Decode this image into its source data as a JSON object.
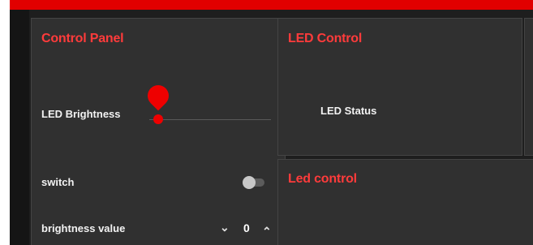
{
  "header": {
    "accent": "#e10000"
  },
  "control_panel": {
    "title": "Control Panel",
    "brightness_label": "LED Brightness",
    "brightness_level": 0,
    "switch_label": "switch",
    "switch_on": false,
    "brightness_value_label": "brightness value",
    "brightness_value": "0",
    "down_icon": "chevron-down-icon",
    "up_icon": "chevron-up-icon"
  },
  "led_control": {
    "title": "LED Control",
    "status_label": "LED Status"
  },
  "led_control_2": {
    "title": "Led control"
  },
  "colors": {
    "accent_red": "#ff3b3b",
    "panel_bg": "#303030",
    "page_bg": "#1e1e1e"
  }
}
